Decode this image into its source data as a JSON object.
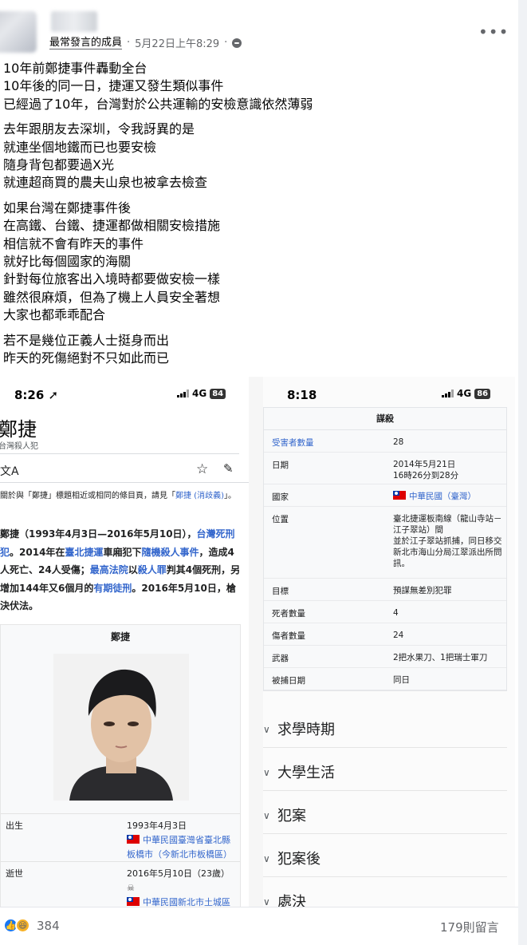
{
  "post": {
    "author_badge": "最常發言的成員",
    "timestamp": "5月22日上午8:29",
    "separator": "·",
    "more_label": "•••",
    "paragraphs": [
      [
        "10年前鄭捷事件轟動全台",
        "10年後的同一日，捷運又發生類似事件",
        "已經過了10年，台灣對於公共運輸的安檢意識依然薄弱"
      ],
      [
        "去年跟朋友去深圳，令我訝異的是",
        "就連坐個地鐵而已也要安檢",
        "隨身背包都要過X光",
        "就連超商買的農夫山泉也被拿去檢查"
      ],
      [
        "如果台灣在鄭捷事件後",
        "在高鐵、台鐵、捷運都做相關安檢措施",
        "相信就不會有昨天的事件",
        "就好比每個國家的海關",
        "針對每位旅客出入境時都要做安檢一樣",
        "雖然很麻煩，但為了機上人員安全著想",
        "大家也都乖乖配合"
      ],
      [
        "若不是幾位正義人士挺身而出",
        "昨天的死傷絕對不只如此而已"
      ]
    ]
  },
  "left_shot": {
    "time": "8:26",
    "network": "4G",
    "battery": "84",
    "title": "鄭捷",
    "subtitle": "台灣殺人犯",
    "lang_icon_label": "文A",
    "hatnote_pre": "關於與「鄭捷」標題相近或相同的條目頁，請見「",
    "hatnote_link": "鄭捷 (消歧義)",
    "hatnote_post": "」。",
    "lead": {
      "p1": "鄭捷（1993年4月3日—2016年5月10日），",
      "link1": "台灣死刑犯",
      "p2": "。2014年在",
      "link2": "臺北捷運",
      "p3": "車廂犯下",
      "link3": "隨機殺人事件",
      "p4": "，造成4人死亡、24人受傷；",
      "link4": "最高法院",
      "p5": "以",
      "link5": "殺人罪",
      "p6": "判其4個死刑，另增加144年又6個月的",
      "link6": "有期徒刑",
      "p7": "。2016年5月10日，槍決伏法。"
    },
    "infobox_title": "鄭捷",
    "born_label": "出生",
    "born_date": "1993年4月3日",
    "born_place": "中華民國臺灣省臺北縣板橋市（今新北市板橋區）",
    "died_label": "逝世",
    "died_date": "2016年5月10日（23歲）",
    "died_place": "中華民國新北市土城區臺北看守所附設臺北監獄刑"
  },
  "right_shot": {
    "time": "8:18",
    "network": "4G",
    "battery": "86",
    "table_title": "謀殺",
    "rows": [
      {
        "k": "受害者數量",
        "v": "28",
        "link": true
      },
      {
        "k": "日期",
        "v": "2014年5月21日\n16時26分到28分"
      },
      {
        "k": "國家",
        "v": "中華民國（臺灣）",
        "flag": true
      },
      {
        "k": "位置",
        "v": "臺北捷運板南線（龍山寺站－江子翠站）間\n並於江子翠站抓捕，同日移交新北市海山分局江翠派出所問訊。"
      },
      {
        "k": "目標",
        "v": "預謀無差別犯罪"
      },
      {
        "k": "死者數量",
        "v": "4"
      },
      {
        "k": "傷者數量",
        "v": "24"
      },
      {
        "k": "武器",
        "v": "2把水果刀、1把瑞士軍刀"
      },
      {
        "k": "被捕日期",
        "v": "同日"
      }
    ],
    "sections": [
      "求學時期",
      "大學生活",
      "犯案",
      "犯案後",
      "處決"
    ]
  },
  "footer": {
    "reaction_count": "384",
    "comment_count": "179則留言"
  },
  "colors": {
    "link": "#3366cc",
    "like": "#1877f2",
    "haha": "#f7b125"
  }
}
